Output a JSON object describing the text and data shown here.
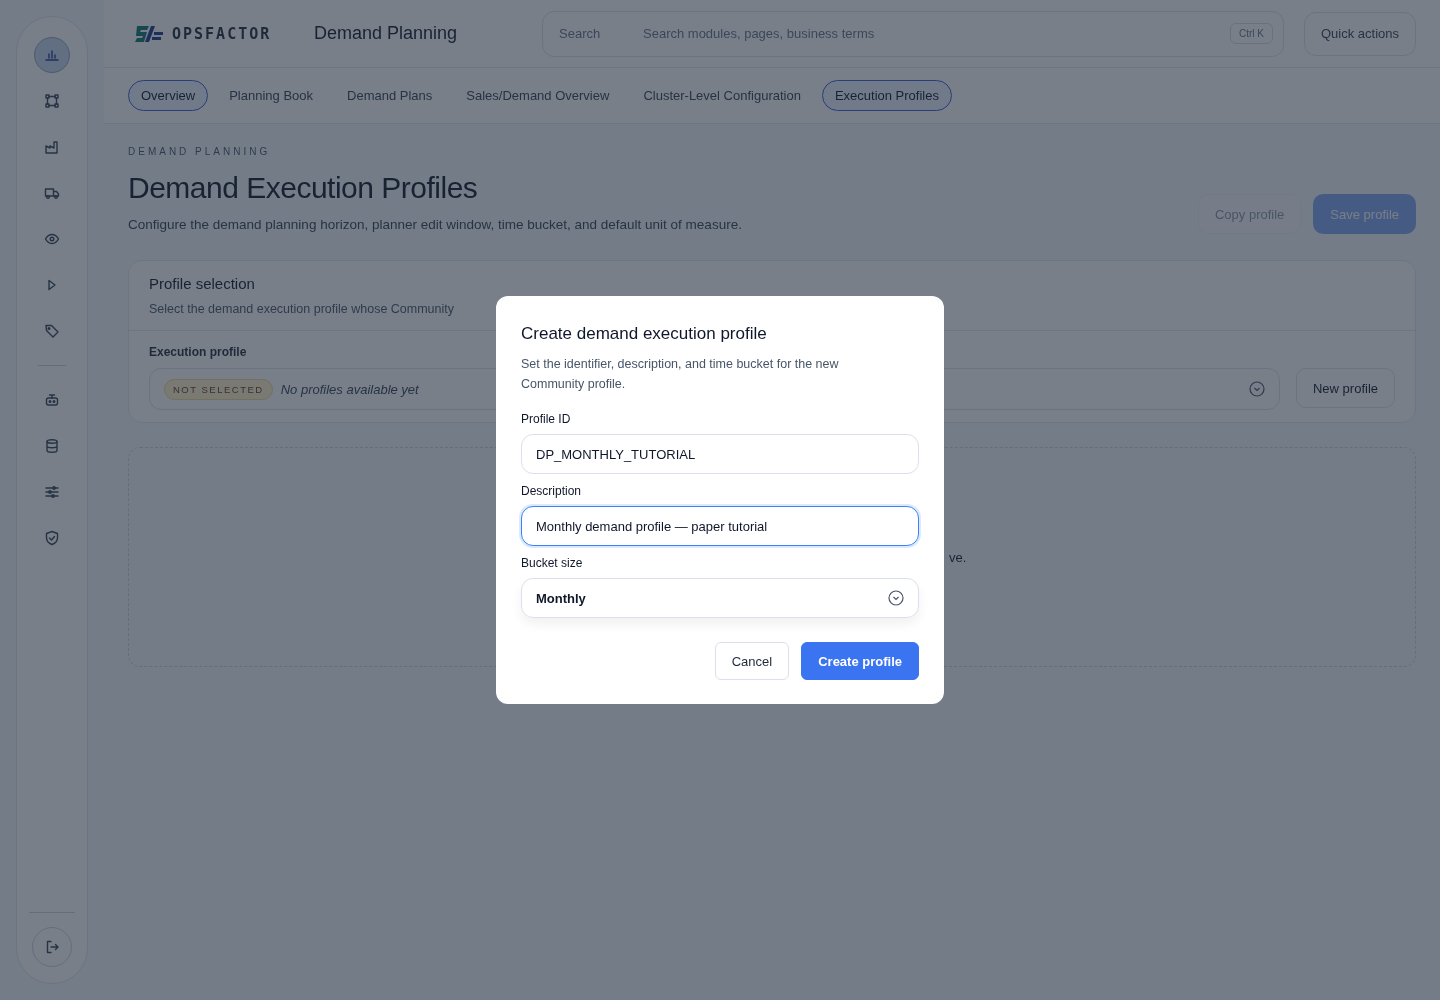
{
  "sidebar": {
    "items": [
      {
        "selected": true
      },
      {
        "selected": false
      },
      {
        "selected": false
      },
      {
        "selected": false
      },
      {
        "selected": false
      },
      {
        "selected": false
      },
      {
        "selected": false
      },
      {
        "selected": false
      },
      {
        "selected": false
      },
      {
        "selected": false
      },
      {
        "selected": false
      }
    ]
  },
  "header": {
    "logo": "OPSFACTOR",
    "title": "Demand Planning",
    "search": {
      "label": "Search",
      "placeholder": "Search modules, pages, business terms",
      "shortcut": "Ctrl K"
    },
    "quick_actions": "Quick actions"
  },
  "tabs": [
    {
      "label": "Overview",
      "selected": true
    },
    {
      "label": "Planning Book",
      "selected": false
    },
    {
      "label": "Demand Plans",
      "selected": false
    },
    {
      "label": "Sales/Demand Overview",
      "selected": false
    },
    {
      "label": "Cluster-Level Configuration",
      "selected": false
    },
    {
      "label": "Execution Profiles",
      "selected": true
    }
  ],
  "page": {
    "eyebrow": "DEMAND PLANNING",
    "title": "Demand Execution Profiles",
    "subtitle": "Configure the demand planning horizon, planner edit window, time bucket, and default unit of measure.",
    "actions": [
      {
        "label": "Copy profile",
        "kind": "secondary",
        "disabled": true
      },
      {
        "label": "Save profile",
        "kind": "primary",
        "disabled": true
      }
    ]
  },
  "profile_selection": {
    "title": "Profile selection",
    "description": "Select the demand execution profile whose Community",
    "field_label": "Execution profile",
    "badge": "NOT SELECTED",
    "value": "No profiles available yet",
    "button": "New profile"
  },
  "empty_state": {
    "text": "ve."
  },
  "modal": {
    "title": "Create demand execution profile",
    "description": "Set the identifier, description, and time bucket for the new Community profile.",
    "fields": [
      {
        "label": "Profile ID",
        "kind": "text",
        "value": "DP_MONTHLY_TUTORIAL",
        "focused": false
      },
      {
        "label": "Description",
        "kind": "text",
        "value": "Monthly demand profile — paper tutorial",
        "focused": true
      },
      {
        "label": "Bucket size",
        "kind": "select",
        "value": "Monthly",
        "focused": false
      }
    ],
    "buttons": [
      {
        "label": "Cancel",
        "kind": "secondary"
      },
      {
        "label": "Create profile",
        "kind": "primary"
      }
    ]
  }
}
